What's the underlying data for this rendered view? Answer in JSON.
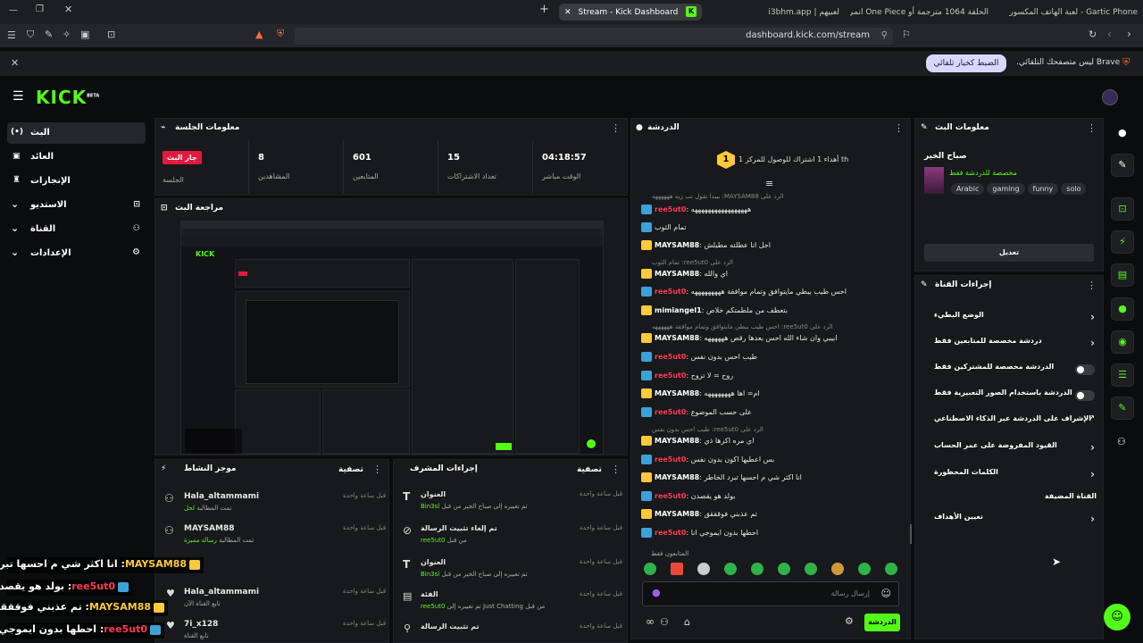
{
  "browser": {
    "tabs": [
      "Stream - Kick Dashboard",
      "i3bhm.app | لعبيهم",
      "انمي One Piece الحلقة 1064 مترجمة أو",
      "لعبة الهاتف المكسور - Gartic Phone"
    ],
    "url": "dashboard.kick.com/stream",
    "infobar_text": "Brave ليس متصفحك التلقائي.",
    "infobar_button": "الضبط كخيار تلقائي"
  },
  "logo": {
    "text": "KICK",
    "beta": "BETA"
  },
  "sidebar": {
    "items": [
      {
        "label": "البث",
        "icon": "broadcast-icon"
      },
      {
        "label": "العائد",
        "icon": "dollar-icon"
      },
      {
        "label": "الإنجازات",
        "icon": "trophy-icon"
      },
      {
        "label": "الاستديو",
        "icon": "studio-icon"
      },
      {
        "label": "القناة",
        "icon": "channel-icon"
      },
      {
        "label": "الإعدادات",
        "icon": "gear-icon"
      }
    ]
  },
  "session": {
    "title": "معلومات الجلسة",
    "live_badge": "جار البث",
    "session_label": "الجلسة",
    "stats": [
      {
        "value": "8",
        "label": "المشاهدين"
      },
      {
        "value": "601",
        "label": "المتابعين"
      },
      {
        "value": "15",
        "label": "تعداد الاشتراكات"
      },
      {
        "value": "04:18:57",
        "label": "الوقت مباشر"
      }
    ]
  },
  "preview": {
    "title": "مراجعة البث"
  },
  "activity": {
    "title": "موجز النشاط",
    "filter": "تصفية",
    "items": [
      {
        "user": "Hala_altammami",
        "text": "تمت المطالبة",
        "highlight": "لحل",
        "time": "قبل ساعة واحدة"
      },
      {
        "user": "MAYSAM88",
        "text": "تمت المطالبة",
        "highlight": "رسالة مميزة",
        "time": "قبل ساعة واحدة"
      },
      {
        "user": "Hala_altammami",
        "text": "تابع القناة الآن",
        "highlight": "",
        "time": "قبل ساعة واحدة"
      },
      {
        "user": "7i_x128",
        "text": "تابع القناة",
        "highlight": "",
        "time": "قبل ساعة واحدة"
      }
    ]
  },
  "mod_actions": {
    "title": "إجراءات المشرف",
    "filter": "تصفية",
    "items": [
      {
        "title": "العنوان",
        "detail": "تم تغييره إلى صباح الخير من قبل",
        "user": "Bin3sl",
        "time": "قبل ساعة واحدة"
      },
      {
        "title": "تم إلغاء تثبيت الرسالة",
        "detail": "من قبل",
        "user": "ree5ut0",
        "time": "قبل ساعة واحدة"
      },
      {
        "title": "العنوان",
        "detail": "تم تغييره إلى صباح الخير من قبل",
        "user": "Bin3sl",
        "time": "قبل ساعة واحدة"
      },
      {
        "title": "الفئة",
        "detail": "تم تغييره إلى Just Chatting من قبل",
        "user": "ree5ut0",
        "time": "قبل ساعة واحدة"
      },
      {
        "title": "تم تثبيت الرسالة",
        "detail": "",
        "user": "",
        "time": "قبل ساعة واحدة"
      }
    ]
  },
  "chat": {
    "title": "الدردشة",
    "pinned": "أهداء 1 اشتراك للوصول للمركز 1 th",
    "pinned_rank": "1",
    "messages": [
      {
        "reply": "الرد على MAYSAM88: بيبدا تقول نب زيه ههههههه",
        "user": "",
        "text": "",
        "badge": "none"
      },
      {
        "user": "ree5ut0",
        "text": "هههههههههههههههههه",
        "badge": "blue",
        "color": "red"
      },
      {
        "user": "",
        "text": "تمام الثوب",
        "badge": "blue",
        "color": "red"
      },
      {
        "user": "MAYSAM88",
        "text": "اجل انا عطلته مطبلش",
        "badge": "gold",
        "color": "white"
      },
      {
        "reply": "الرد على ree5ut0: تمام الثوب",
        "user": "",
        "text": "",
        "badge": "none"
      },
      {
        "user": "MAYSAM88",
        "text": "اي والله",
        "badge": "gold",
        "color": "white"
      },
      {
        "user": "ree5ut0",
        "text": "احس طيب بيطي مايتوافق وتمام موافقة هههههههههه",
        "badge": "blue",
        "color": "red"
      },
      {
        "user": "mimiangel1",
        "text": "بتعطف من ملطمتكم خلاص",
        "badge": "gold",
        "color": "white"
      },
      {
        "reply": "الرد على ree5ut0: احس طيب بيطي مايتوافق وتمام موافقة ههههههه",
        "user": "",
        "text": "",
        "badge": "none"
      },
      {
        "user": "MAYSAM88",
        "text": "ابيبي وان شاء الله احس بعدها رقص ههههههه",
        "badge": "gold",
        "color": "white"
      },
      {
        "user": "ree5ut0",
        "text": "طيب احس بدون نفس",
        "badge": "blue",
        "color": "red"
      },
      {
        "user": "ree5ut0",
        "text": "روح = لا تروح",
        "badge": "blue",
        "color": "red"
      },
      {
        "user": "MAYSAM88",
        "text": "ام= اها ههههههههه",
        "badge": "gold",
        "color": "white"
      },
      {
        "user": "ree5ut0",
        "text": "على حسب الموضوع",
        "badge": "blue",
        "color": "red"
      },
      {
        "reply": "الرد على ree5ut0: طيب احس بدون نفس",
        "user": "",
        "text": "",
        "badge": "none"
      },
      {
        "user": "MAYSAM88",
        "text": "اي مره اكرها ذي",
        "badge": "gold",
        "color": "white"
      },
      {
        "user": "ree5ut0",
        "text": "بس اعطيها اكون بدون نفس",
        "badge": "blue",
        "color": "red"
      },
      {
        "user": "MAYSAM88",
        "text": "انا اكثر شي م احسها تبرد الخاطر",
        "badge": "gold",
        "color": "white"
      },
      {
        "user": "ree5ut0",
        "text": "بولد هو يقصدن",
        "badge": "blue",
        "color": "red"
      },
      {
        "user": "MAYSAM88",
        "text": "تم عذبني فوقققق",
        "badge": "gold",
        "color": "white"
      },
      {
        "user": "ree5ut0",
        "text": "احطها بدون ايموجي انا",
        "badge": "blue",
        "color": "red"
      }
    ],
    "followers_only": "المتابعون فقط",
    "input_placeholder": "إرسال رسالة",
    "send_button": "الدردشة"
  },
  "stream_info": {
    "title": "معلومات البث",
    "stream_title": "صباح الخير",
    "category": "مخصصة للدردشة فقط",
    "tags": [
      "Arabic",
      "gaming",
      "funny",
      "solo"
    ],
    "edit_button": "تعديل"
  },
  "channel_actions": {
    "title": "إجراءات القناة",
    "rows": [
      {
        "label": "الوضع البطيء",
        "control": "chevron"
      },
      {
        "label": "دردشة مخصصة للمتابعين فقط",
        "control": "chevron"
      },
      {
        "label": "الدردشة مخصصة للمشتركين فقط",
        "control": "toggle"
      },
      {
        "label": "الدردشة باستخدام الصور التعبيرية فقط",
        "control": "toggle"
      },
      {
        "label": "الإشراف على الدردشة عبر الذكاء الاصطناعي",
        "control": "external"
      },
      {
        "label": "القيود المفروضة على عمر الحساب",
        "control": "chevron"
      },
      {
        "label": "الكلمات المحظورة",
        "control": "chevron"
      },
      {
        "label": "القناة المضيفة",
        "control": "none"
      },
      {
        "label": "تعيين الأهداف",
        "control": "chevron"
      }
    ]
  },
  "overlay": {
    "lines": [
      {
        "user": "MAYSAM88",
        "text": "انا اكثر شي م احسها تبرد الخاطر",
        "badge": "gold"
      },
      {
        "user": "ree5ut0",
        "text": "بولد هو يقصدن",
        "badge": "blue"
      },
      {
        "user": "MAYSAM88",
        "text": "تم عذبني فوقققق",
        "badge": "gold"
      },
      {
        "user": "ree5ut0",
        "text": "احطها بدون ايموجي انا",
        "badge": "blue"
      }
    ]
  },
  "colors": {
    "accent": "#53fc18",
    "live": "#ff2e4c",
    "mod_red": "#ff3a55",
    "gold": "#ffc93a",
    "blue": "#3aa2d8"
  }
}
